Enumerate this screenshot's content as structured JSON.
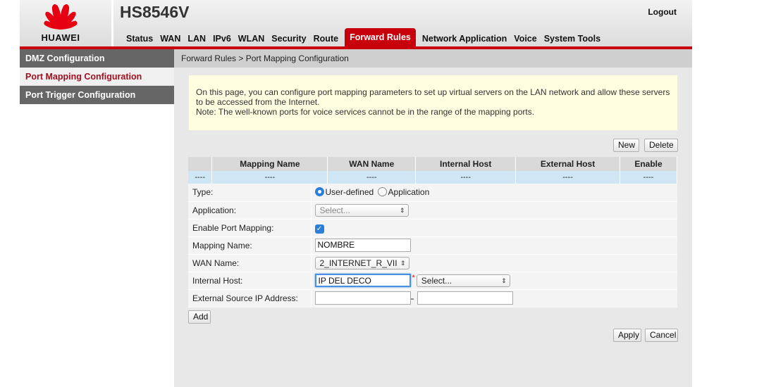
{
  "header": {
    "logo_text": "HUAWEI",
    "model": "HS8546V",
    "logout_label": "Logout",
    "brand_color": "#c7000b",
    "nav": [
      {
        "label": "Status"
      },
      {
        "label": "WAN"
      },
      {
        "label": "LAN"
      },
      {
        "label": "IPv6"
      },
      {
        "label": "WLAN"
      },
      {
        "label": "Security"
      },
      {
        "label": "Route"
      },
      {
        "label": "Forward Rules",
        "active": true
      },
      {
        "label": "Network Application"
      },
      {
        "label": "Voice"
      },
      {
        "label": "System Tools"
      }
    ]
  },
  "sidebar": {
    "items": [
      {
        "label": "DMZ Configuration"
      },
      {
        "label": "Port Mapping Configuration",
        "selected": true
      },
      {
        "label": "Port Trigger Configuration"
      }
    ]
  },
  "main": {
    "breadcrumb": "Forward Rules > Port Mapping Configuration",
    "notice_line1": "On this page, you can configure port mapping parameters to set up virtual servers on the LAN network and allow these servers to be accessed from the Internet.",
    "notice_line2": "Note: The well-known ports for voice services cannot be in the range of the mapping ports.",
    "new_label": "New",
    "delete_label": "Delete",
    "table": {
      "headers": [
        "",
        "Mapping Name",
        "WAN Name",
        "Internal Host",
        "External Host",
        "Enable"
      ],
      "empty_row": [
        "----",
        "----",
        "----",
        "----",
        "----",
        "----"
      ]
    },
    "form": {
      "type_label": "Type:",
      "type_option_user": "User-defined",
      "type_option_app": "Application",
      "application_label": "Application:",
      "application_value": "Select...",
      "enable_label": "Enable Port Mapping:",
      "enable_checked": true,
      "mapping_name_label": "Mapping Name:",
      "mapping_name_value": "NOMBRE",
      "wan_name_label": "WAN Name:",
      "wan_name_value": "2_INTERNET_R_VII",
      "internal_host_label": "Internal Host:",
      "internal_host_value": "IP DEL DECO",
      "internal_host_required": "*",
      "internal_host_select": "Select...",
      "ext_source_label": "External Source IP Address:",
      "ext_source_start": "",
      "ext_source_sep": "--",
      "ext_source_end": ""
    },
    "add_label": "Add",
    "apply_label": "Apply",
    "cancel_label": "Cancel"
  }
}
